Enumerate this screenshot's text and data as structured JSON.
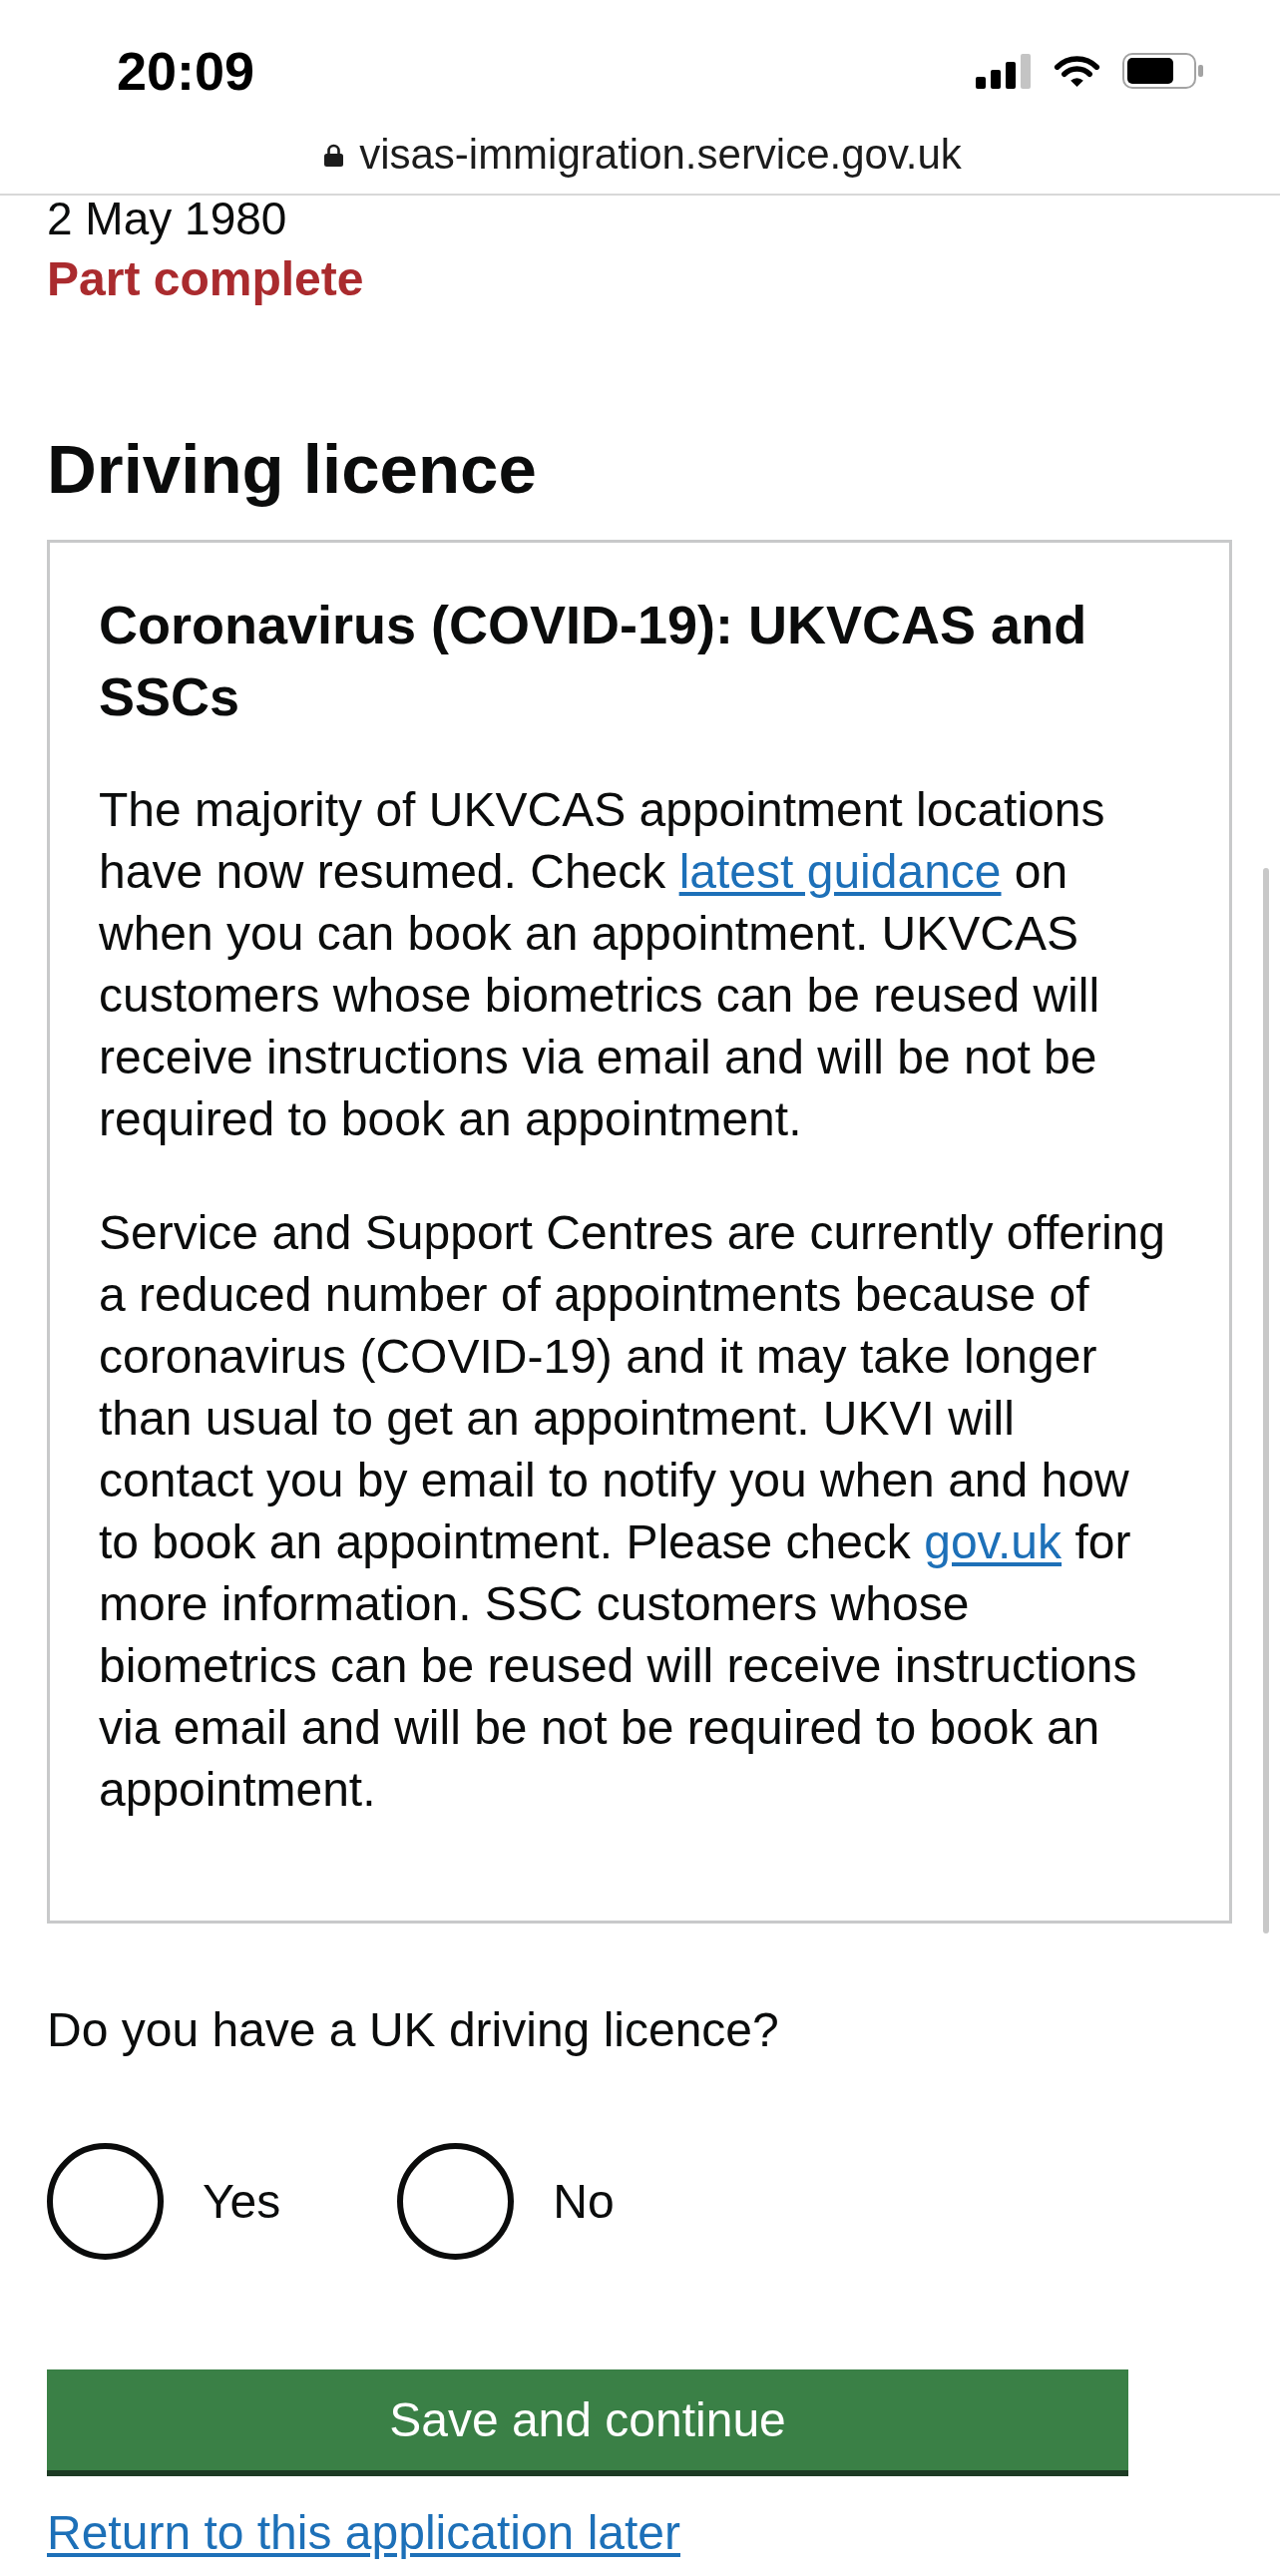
{
  "status_bar": {
    "time": "20:09"
  },
  "address_bar": {
    "url": "visas-immigration.service.gov.uk"
  },
  "summary": {
    "value": "2 May 1980",
    "status": "Part complete"
  },
  "section": {
    "title": "Driving licence"
  },
  "notice": {
    "title": "Coronavirus (COVID-19): UKVCAS and SSCs",
    "paragraphs": [
      [
        {
          "kind": "text",
          "text": "The majority of UKVCAS appointment locations have now resumed. Check "
        },
        {
          "kind": "link",
          "text": "latest guidance"
        },
        {
          "kind": "text",
          "text": " on when you can book an appointment. UKVCAS customers whose biometrics can be reused will receive instructions via email and will be not be required to book an appointment."
        }
      ],
      [
        {
          "kind": "text",
          "text": "Service and Support Centres are currently offering a reduced number of appointments because of coronavirus (COVID-19) and it may take longer than usual to get an appointment. UKVI will contact you by email to notify you when and how to book an appointment. Please check "
        },
        {
          "kind": "link",
          "text": "gov.uk"
        },
        {
          "kind": "text",
          "text": " for more information. SSC customers whose biometrics can be reused will receive instructions via email and will be not be required to book an appointment."
        }
      ]
    ]
  },
  "question": {
    "label": "Do you have a UK driving licence?",
    "options": [
      {
        "label": "Yes",
        "selected": false
      },
      {
        "label": "No",
        "selected": false
      }
    ]
  },
  "primary_button": {
    "label": "Save and continue"
  },
  "secondary_link": {
    "label": "Return to this application later"
  }
}
